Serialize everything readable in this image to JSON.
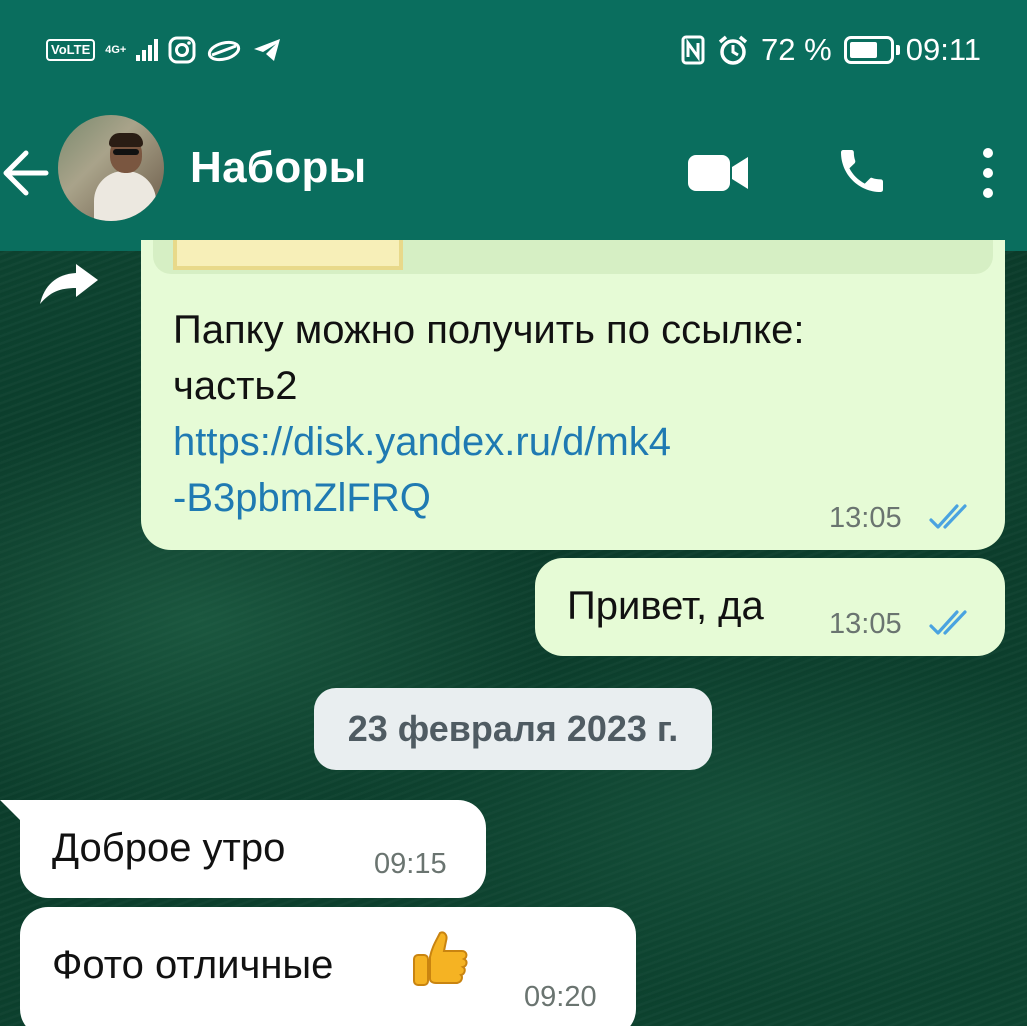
{
  "status_bar": {
    "volte": "VoLTE",
    "network": "4G+",
    "battery_percent": "72 %",
    "battery_level": 0.72,
    "time": "09:11",
    "icons": [
      "signal-icon",
      "instagram-icon",
      "cloud-icon",
      "telegram-icon",
      "nfc-icon",
      "alarm-icon",
      "battery-icon"
    ]
  },
  "header": {
    "contact_name": "Наборы",
    "icons": [
      "back-arrow-icon",
      "video-call-icon",
      "phone-icon",
      "more-vert-icon"
    ]
  },
  "colors": {
    "header": "#0a6e5e",
    "outgoing_bubble": "#e6fbd6",
    "incoming_bubble": "#ffffff",
    "link": "#1f7ab2",
    "read_ticks": "#4aa3e0"
  },
  "messages": [
    {
      "direction": "out",
      "forwarded": true,
      "text_line1": "Папку можно получить по ссылке:",
      "text_line2": "часть2",
      "link_line1": "https://disk.yandex.ru/d/mk4",
      "link_line2": "-B3pbmZlFRQ",
      "time": "13:05",
      "status": "read"
    },
    {
      "direction": "out",
      "text": "Привет, да",
      "time": "13:05",
      "status": "read"
    },
    {
      "type": "date",
      "text": "23 февраля 2023 г."
    },
    {
      "direction": "in",
      "text": "Доброе утро",
      "time": "09:15"
    },
    {
      "direction": "in",
      "text": "Фото отличные",
      "emoji": "thumbs-up",
      "time": "09:20"
    }
  ]
}
